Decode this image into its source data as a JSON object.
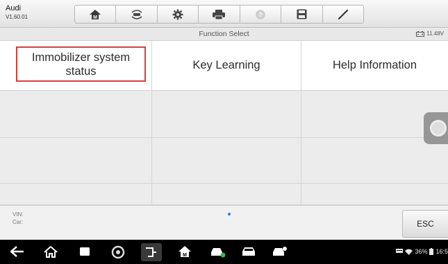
{
  "header": {
    "app_name": "Audi",
    "app_version": "V1.60.01",
    "toolbar_icons": [
      "home-icon",
      "vehicle-swap-icon",
      "settings-icon",
      "print-icon",
      "help-icon",
      "save-icon",
      "pen-icon"
    ]
  },
  "titlebar": {
    "title": "Function Select",
    "battery_voltage": "11.48V"
  },
  "functions": {
    "items": [
      {
        "label": "Immobilizer system status",
        "selected": true
      },
      {
        "label": "Key Learning",
        "selected": false
      },
      {
        "label": "Help Information",
        "selected": false
      }
    ]
  },
  "footer": {
    "vin_label": "VIN:",
    "car_label": "Car:",
    "esc_label": "ESC"
  },
  "status_bar": {
    "battery_percent": "36%",
    "time": "16:5"
  },
  "colors": {
    "selection_border": "#e23a3a",
    "empty_cell": "#ececec",
    "nav_background": "#000000"
  }
}
